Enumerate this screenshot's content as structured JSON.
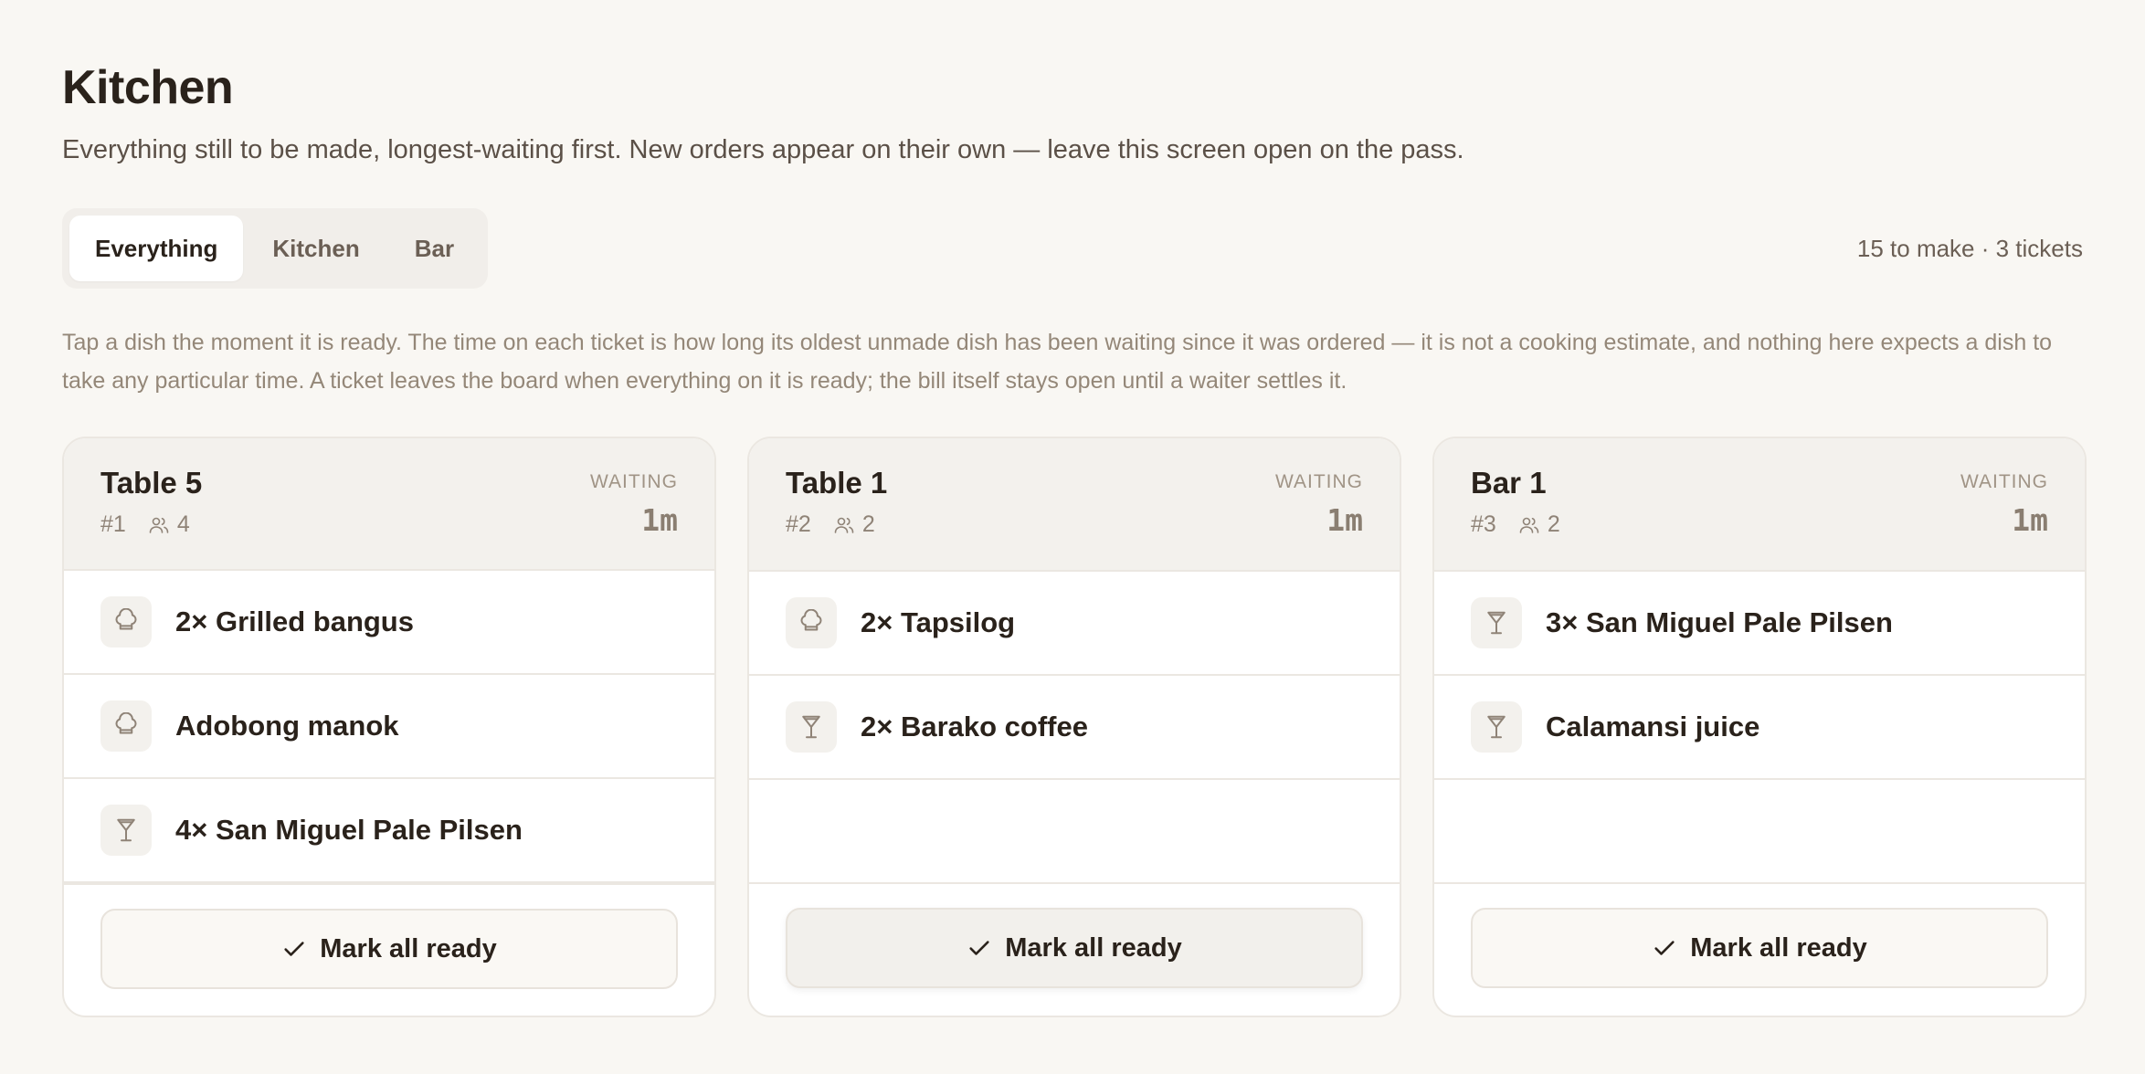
{
  "header": {
    "title": "Kitchen",
    "subtitle": "Everything still to be made, longest-waiting first. New orders appear on their own — leave this screen open on the pass."
  },
  "tabs": [
    {
      "label": "Everything",
      "active": true
    },
    {
      "label": "Kitchen",
      "active": false
    },
    {
      "label": "Bar",
      "active": false
    }
  ],
  "summary": "15 to make · 3 tickets",
  "help": "Tap a dish the moment it is ready. The time on each ticket is how long its oldest unmade dish has been waiting since it was ordered — it is not a cooking estimate, and nothing here expects a dish to take any particular time. A ticket leaves the board when everything on it is ready; the bill itself stays open until a waiter settles it.",
  "waiting_label": "WAITING",
  "button_label": "Mark all ready",
  "tickets": [
    {
      "name": "Table 5",
      "number": "#1",
      "guests": "4",
      "waiting": "1m",
      "items": [
        {
          "text": "2× Grilled bangus",
          "icon": "chef-hat-icon"
        },
        {
          "text": "Adobong manok",
          "icon": "chef-hat-icon"
        },
        {
          "text": "4× San Miguel Pale Pilsen",
          "icon": "cocktail-glass-icon"
        }
      ]
    },
    {
      "name": "Table 1",
      "number": "#2",
      "guests": "2",
      "waiting": "1m",
      "items": [
        {
          "text": "2× Tapsilog",
          "icon": "chef-hat-icon"
        },
        {
          "text": "2× Barako coffee",
          "icon": "cocktail-glass-icon"
        }
      ]
    },
    {
      "name": "Bar 1",
      "number": "#3",
      "guests": "2",
      "waiting": "1m",
      "items": [
        {
          "text": "3× San Miguel Pale Pilsen",
          "icon": "cocktail-glass-icon"
        },
        {
          "text": "Calamansi juice",
          "icon": "cocktail-glass-icon"
        }
      ]
    }
  ]
}
